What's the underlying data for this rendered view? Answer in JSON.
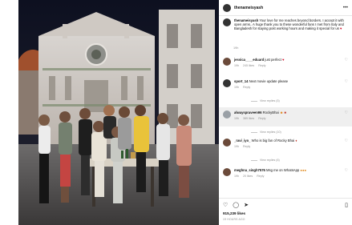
{
  "post": {
    "username": "thenameisyash",
    "more_icon": "more-horizontal-icon",
    "caption_text": "Your love for me reaches beyond borders. I accept it with open arms.. A huge thank you to these wonderful fans I met from Italy and Bangladesh for staying post working hours and making it special for us",
    "caption_time": "19h"
  },
  "comments": [
    {
      "user": "jessica____eduard",
      "text": "just perfect",
      "time": "19h",
      "likes": "245 likes",
      "reply": "Reply",
      "replies": null
    },
    {
      "user": "sport_14",
      "text": "Next movie update please",
      "time": "19h",
      "likes": "",
      "reply": "Reply",
      "replies": "View replies (5)"
    },
    {
      "user": "alwayspraveen96",
      "text": "RockyBhai",
      "time": "19h",
      "likes": "389 likes",
      "reply": "Reply",
      "replies": "View replies (10)"
    },
    {
      "user": "_ravi_iyo_",
      "text": "Who is big fan of Rocky Bhai",
      "time": "19h",
      "likes": "",
      "reply": "Reply",
      "replies": "View replies (6)"
    },
    {
      "user": "meghna_singh7576",
      "text": "Msg me on WhatsApp",
      "time": "19h",
      "likes": "20 likes",
      "reply": "Reply",
      "replies": null
    }
  ],
  "stats": {
    "likes": "915,239 likes",
    "time_ago": "19 HOURS AGO"
  },
  "icons": {
    "like": "heart-icon",
    "comment": "comment-icon",
    "share": "send-icon",
    "save": "bookmark-icon"
  }
}
